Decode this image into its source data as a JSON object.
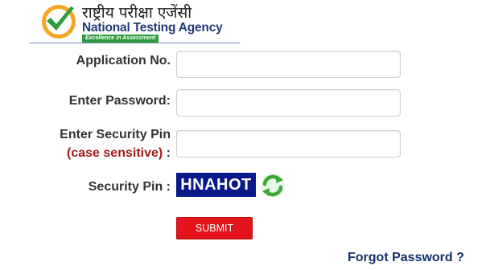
{
  "logo": {
    "hindi_text": "राष्ट्रीय परीक्षा एजेंसी",
    "english_text": "National Testing Agency",
    "tagline": "Excellence in Assessment"
  },
  "form": {
    "application_no_label": "Application No.",
    "application_no_value": "",
    "password_label": "Enter Password:",
    "password_value": "",
    "security_pin_label": "Enter Security Pin",
    "security_pin_note": "(case sensitive)",
    "security_pin_note_colon": " :",
    "security_pin_value": "",
    "captcha_label": "Security Pin :",
    "captcha_text": "HNAHOT",
    "captcha_refresh_icon": "refresh-icon",
    "submit_label": "SUBMIT",
    "forgot_password": "Forgot Password ?"
  },
  "colors": {
    "submit_bg": "#e3141b",
    "captcha_bg": "#0a1a8a",
    "note_red": "#a11c1c",
    "link_blue": "#15306a",
    "logo_green": "#2d9c3c"
  }
}
